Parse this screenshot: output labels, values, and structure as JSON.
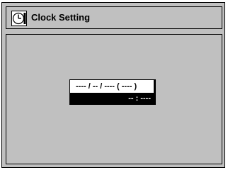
{
  "header": {
    "title": "Clock Setting",
    "icon": "clock-icon"
  },
  "clock": {
    "date": "---- / -- / ---- ( ---- )",
    "time": "-- : ----"
  },
  "colors": {
    "panel": "#c0c0c0",
    "highlight": "#ffffff",
    "box": "#000000"
  }
}
